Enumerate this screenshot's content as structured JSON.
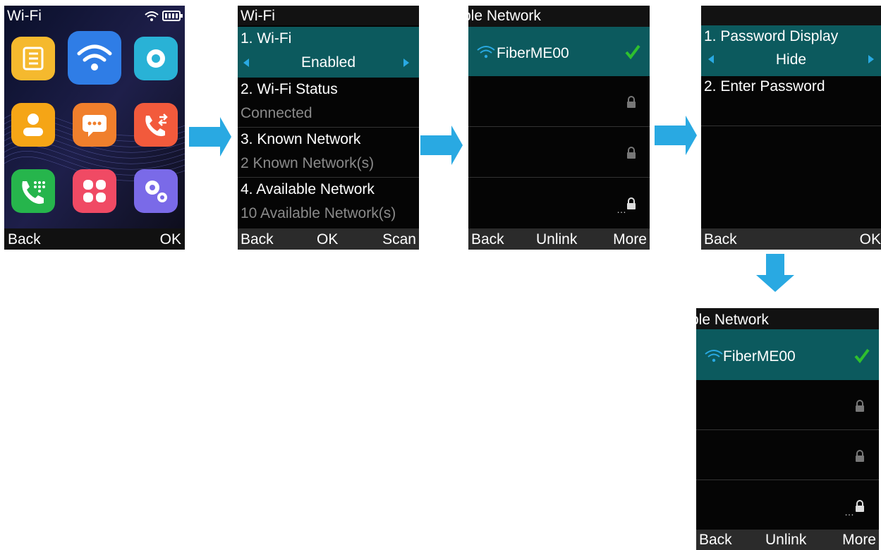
{
  "screen1": {
    "title": "Wi-Fi",
    "soft_left": "Back",
    "soft_right": "OK",
    "apps": [
      {
        "name": "directory-app",
        "color": "#f5b92e"
      },
      {
        "name": "wifi-app",
        "color": "#2f7de6"
      },
      {
        "name": "settings-app",
        "color": "#29b2d6"
      },
      {
        "name": "contacts-app",
        "color": "#f5a516"
      },
      {
        "name": "messages-app",
        "color": "#f07f2c"
      },
      {
        "name": "call-forward-app",
        "color": "#f25a3c"
      },
      {
        "name": "dialer-app",
        "color": "#26b54c"
      },
      {
        "name": "features-app",
        "color": "#f04a64"
      },
      {
        "name": "advanced-settings-app",
        "color": "#7a6ae8"
      }
    ]
  },
  "screen2": {
    "title": "Wi-Fi",
    "items": [
      {
        "label": "1. Wi-Fi",
        "value": "Enabled"
      },
      {
        "label": "2. Wi-Fi Status",
        "value": "Connected"
      },
      {
        "label": "3. Known Network",
        "value": "2 Known Network(s)"
      },
      {
        "label": "4. Available Network",
        "value": "10 Available Network(s)"
      }
    ],
    "soft_left": "Back",
    "soft_mid": "OK",
    "soft_right": "Scan"
  },
  "screen3": {
    "title": "ble Network",
    "network": "FiberME00",
    "soft_left": "Back",
    "soft_mid": "Unlink",
    "soft_right": "More"
  },
  "screen4": {
    "title": "",
    "items": [
      {
        "label": "1. Password Display",
        "value": "Hide"
      },
      {
        "label": "2. Enter Password"
      }
    ],
    "soft_left": "Back",
    "soft_right": "OK"
  },
  "screen5": {
    "title": "ble Network",
    "network": "FiberME00",
    "soft_left": "Back",
    "soft_mid": "Unlink",
    "soft_right": "More"
  },
  "colors": {
    "accent": "#29a9e2",
    "selected_row": "#0c5a5e",
    "check": "#2ec02e"
  }
}
